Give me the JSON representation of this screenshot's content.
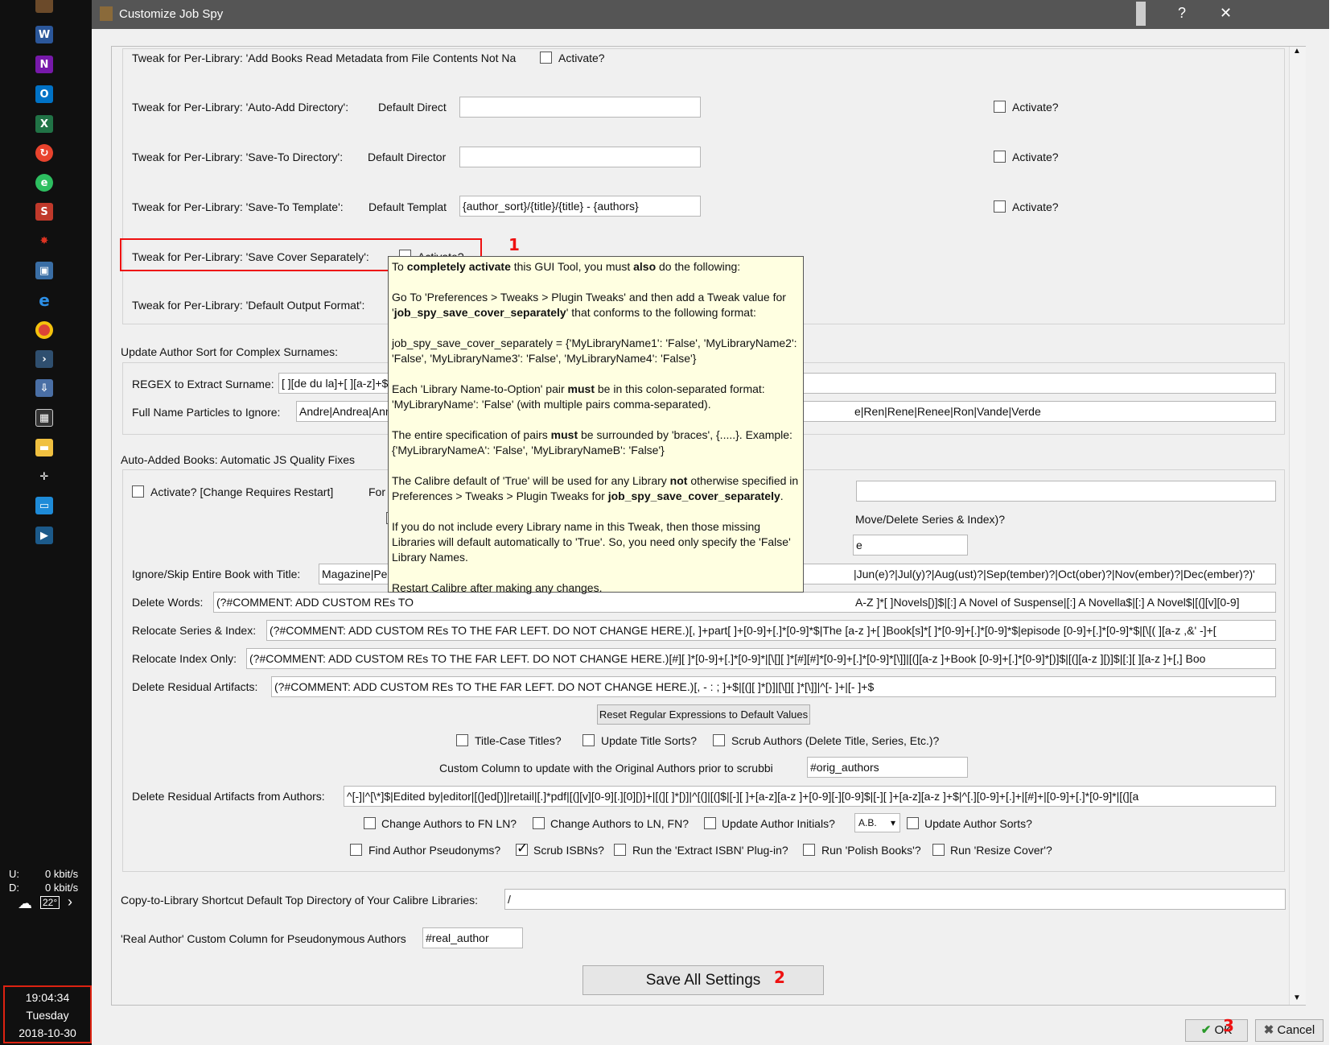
{
  "taskbar": {
    "upload_label": "U:",
    "upload_value": "0 kbit/s",
    "download_label": "D:",
    "download_value": "0 kbit/s",
    "temp": "22°",
    "clock_time": "19:04:34",
    "clock_day": "Tuesday",
    "clock_date": "2018-10-30"
  },
  "window": {
    "title": "Customize Job Spy",
    "help": "?",
    "close": "✕"
  },
  "tweaks": {
    "add_books_label": "Tweak for Per-Library: 'Add Books Read Metadata from File Contents Not Na",
    "activate": "Activate?",
    "auto_add_label": "Tweak for Per-Library: 'Auto-Add Directory':",
    "auto_add_default": "Default Direct",
    "save_to_dir_label": "Tweak for Per-Library: 'Save-To Directory':",
    "save_to_dir_default": "Default Director",
    "save_to_template_label": "Tweak for Per-Library: 'Save-To Template':",
    "save_to_template_default": "Default Templat",
    "save_to_template_value": "{author_sort}/{title}/{title} - {authors}",
    "save_cover_label": "Tweak for Per-Library: 'Save Cover Separately':",
    "default_output_label": "Tweak for Per-Library: 'Default Output Format':"
  },
  "author_sort": {
    "heading": "Update Author Sort for Complex Surnames:",
    "regex_label": "REGEX to Extract Surname:",
    "regex_value": "[ ][de du la]+[ ][a-z]+$|[",
    "particles_label": "Full Name Particles to Ignore:",
    "particles_value_left": "Andre|Andrea|Ann|Ar",
    "particles_value_right": "e|Ren|Rene|Renee|Ron|Vande|Verde"
  },
  "quality": {
    "heading": "Auto-Added Books: Automatic JS Quality Fixes",
    "activate_restart": "Activate?  [Change Requires Restart]",
    "for_libra": "For Libra",
    "move_delete": "Move/Delete Series & Index)?",
    "field_e": "e",
    "ignore_label": "Ignore/Skip Entire Book with Title:",
    "ignore_value_left": "Magazine|Period",
    "ignore_value_right": "|Jun(e)?|Jul(y)?|Aug(ust)?|Sep(tember)?|Oct(ober)?|Nov(ember)?|Dec(ember)?)'",
    "delete_words_label": "Delete Words:",
    "delete_words_left": "(?#COMMENT: ADD CUSTOM REs TO",
    "delete_words_right": "A-Z ]*[ ]Novels[)]$|[:] A Novel of Suspense|[:] A Novella$|[:] A Novel$|[(][v][0-9]",
    "relocate_series_label": "Relocate Series & Index:",
    "relocate_series_value": "(?#COMMENT: ADD CUSTOM REs TO THE FAR LEFT. DO NOT CHANGE HERE.)[, ]+part[ ]+[0-9]+[.]*[0-9]*$|The [a-z ]+[ ]Book[s]*[ ]*[0-9]+[.]*[0-9]*$|episode [0-9]+[.]*[0-9]*$|[\\[( ][a-z ,&' -]+[",
    "relocate_index_label": "Relocate Index Only:",
    "relocate_index_value": "(?#COMMENT: ADD CUSTOM REs TO THE FAR LEFT. DO NOT CHANGE HERE.)[#][ ]*[0-9]+[.]*[0-9]*|[\\[][ ]*[#][#]*[0-9]+[.]*[0-9]*[\\]]|[(][a-z ]+Book [0-9]+[.]*[0-9]*[)]$|[(][a-z ][)]$|[:][ ][a-z ]+[,] Boo",
    "delete_residual_label": "Delete Residual Artifacts:",
    "delete_residual_value": "(?#COMMENT: ADD CUSTOM REs TO THE FAR LEFT. DO NOT CHANGE HERE.)[, - : ; ]+$|[(][ ]*[)]|[\\[][ ]*[\\]]|^[- ]+|[- ]+$",
    "reset_button": "Reset Regular Expressions to Default Values",
    "title_case": "Title-Case Titles?",
    "update_title_sorts": "Update Title Sorts?",
    "scrub_authors": "Scrub Authors (Delete Title, Series, Etc.)?",
    "custom_col_label": "Custom Column to update with the Original Authors prior to scrubbi",
    "custom_col_value": "#orig_authors",
    "delete_residual_authors_label": "Delete Residual Artifacts from Authors:",
    "delete_residual_authors_value": "^[-]|^[\\*]$|Edited by|editor|[(]ed[)]|retail|[.]*pdf|[(][v][0-9][.][0][)]+|[(][ ]*[)]|^[(]|[(]$|[-][ ]+[a-z][a-z ]+[0-9][-][0-9]$|[-][ ]+[a-z][a-z ]+$|^[.][0-9]+[.]+|[#]+|[0-9]+[.]*[0-9]*|[(][a",
    "change_fn_ln": "Change Authors to FN LN?",
    "change_ln_fn": "Change Authors to LN, FN?",
    "update_initials": "Update Author Initials?",
    "initials_combo": "A.B.",
    "update_author_sorts": "Update Author Sorts?",
    "find_pseudonyms": "Find Author Pseudonyms?",
    "scrub_isbns": "Scrub ISBNs?",
    "run_extract_isbn": "Run the 'Extract ISBN' Plug-in?",
    "run_polish": "Run 'Polish Books'?",
    "run_resize": "Run 'Resize Cover'?"
  },
  "copy_to_library": {
    "label": "Copy-to-Library Shortcut Default Top Directory of Your Calibre Libraries:",
    "value": "/"
  },
  "real_author": {
    "label": "'Real Author' Custom Column for Pseudonymous Authors",
    "value": "#real_author"
  },
  "save_all": "Save All Settings",
  "ok": "OK",
  "cancel": "Cancel",
  "annotations": {
    "one": "1",
    "two": "2",
    "three": "3"
  },
  "tooltip": {
    "p1_a": "To ",
    "p1_b": "completely activate",
    "p1_c": " this GUI Tool, you must ",
    "p1_d": "also",
    "p1_e": " do the following:",
    "p2_a": "Go To 'Preferences > Tweaks > Plugin Tweaks' and then add a Tweak value for '",
    "p2_b": "job_spy_save_cover_separately",
    "p2_c": "' that conforms to the following format:",
    "p3": "job_spy_save_cover_separately = {'MyLibraryName1': 'False', 'MyLibraryName2': 'False', 'MyLibraryName3': 'False', 'MyLibraryName4': 'False'}",
    "p4_a": "Each 'Library Name-to-Option' pair ",
    "p4_b": "must",
    "p4_c": " be in this colon-separated format: 'MyLibraryName': 'False' (with multiple pairs comma-separated).",
    "p5_a": "The entire specification of pairs ",
    "p5_b": "must",
    "p5_c": " be surrounded by 'braces', {.....}. Example: {'MyLibraryNameA': 'False', 'MyLibraryNameB': 'False'}",
    "p6_a": "The Calibre default of 'True' will be used for any Library ",
    "p6_b": "not",
    "p6_c": " otherwise specified in Preferences > Tweaks > Plugin Tweaks for ",
    "p6_d": "job_spy_save_cover_separately",
    "p6_e": ".",
    "p7": "If you do not include every Library name in this Tweak, then those missing Libraries will default automatically to 'True'. So, you need only specify the 'False' Library Names.",
    "p8": "Restart Calibre after making any changes."
  },
  "colors": {
    "annotation": "#ee1111",
    "tooltip_bg": "#ffffe1",
    "titlebar": "#555555"
  }
}
